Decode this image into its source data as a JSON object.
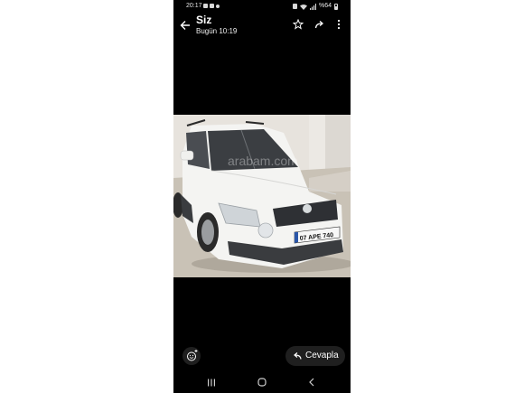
{
  "status_bar": {
    "time": "20:17",
    "battery": "%64"
  },
  "app_bar": {
    "title": "Siz",
    "subtitle": "Bugün 10:19",
    "icons": [
      "back-arrow-icon",
      "star-icon",
      "forward-icon",
      "more-vert-icon"
    ]
  },
  "photo": {
    "subject": "white car",
    "plate": "07 APE 740",
    "watermark": "arabam.com"
  },
  "bottom_bar": {
    "reply_label": "Cevapla",
    "icons": [
      "emoji-add-icon",
      "reply-icon"
    ]
  },
  "nav_bar": {
    "icons": [
      "recents-icon",
      "home-icon",
      "nav-back-icon"
    ]
  },
  "colors": {
    "background": "#000000",
    "surface": "#1f1f1f",
    "text": "#ffffff",
    "car_body": "#f3f3f1"
  }
}
